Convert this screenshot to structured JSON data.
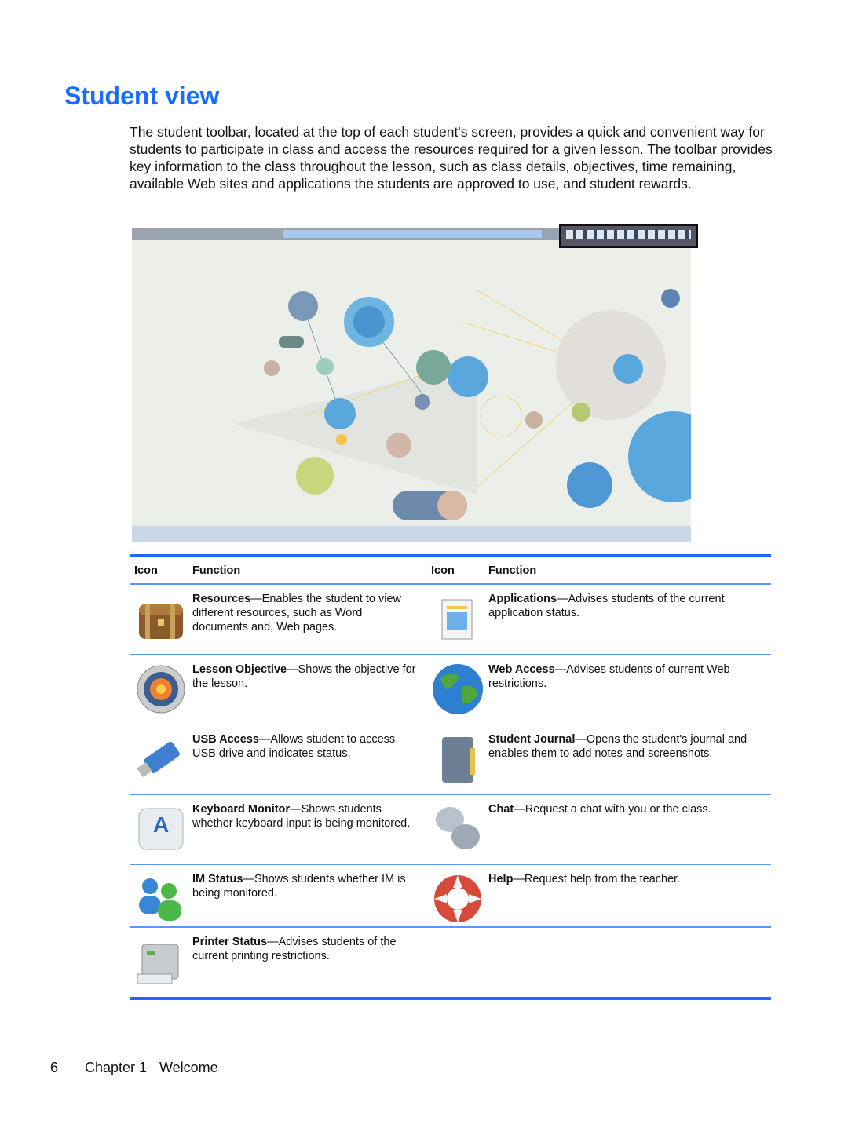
{
  "page": {
    "title": "Student view",
    "intro": "The student toolbar, located at the top of each student's screen, provides a quick and convenient way for students to participate in class and access the resources required for a given lesson. The toolbar provides key information to the class throughout the lesson, such as class details, objectives, time remaining, available Web sites and applications the students are approved to use, and student rewards."
  },
  "table": {
    "headers": [
      "Icon",
      "Function",
      "Icon",
      "Function"
    ],
    "rows": [
      [
        {
          "icon": "treasure-chest-icon",
          "name": "Resources",
          "desc": "—Enables the student to view different resources, such as Word documents and, Web pages."
        },
        {
          "icon": "application-document-icon",
          "name": "Applications",
          "desc": "—Advises students of the current application status."
        }
      ],
      [
        {
          "icon": "target-icon",
          "name": "Lesson Objective",
          "desc": "—Shows the objective for the lesson."
        },
        {
          "icon": "globe-icon",
          "name": "Web Access",
          "desc": "—Advises students of current Web restrictions."
        }
      ],
      [
        {
          "icon": "usb-drive-icon",
          "name": "USB Access",
          "desc": "—Allows student to access USB drive and indicates status."
        },
        {
          "icon": "journal-book-icon",
          "name": "Student Journal",
          "desc": "—Opens the student's journal and enables them to add notes and screenshots."
        }
      ],
      [
        {
          "icon": "keyboard-key-icon",
          "name": "Keyboard Monitor",
          "desc": "—Shows students whether keyboard input is being monitored."
        },
        {
          "icon": "chat-bubbles-icon",
          "name": "Chat",
          "desc": "—Request a chat with you or the class."
        }
      ],
      [
        {
          "icon": "im-users-icon",
          "name": "IM Status",
          "desc": "—Shows students whether IM is being monitored."
        },
        {
          "icon": "lifebuoy-icon",
          "name": "Help",
          "desc": "—Request help from the teacher."
        }
      ],
      [
        {
          "icon": "printer-icon",
          "name": "Printer Status",
          "desc": "—Advises students of the current printing restrictions."
        },
        null
      ]
    ]
  },
  "footer": {
    "page_number": "6",
    "chapter": "Chapter 1",
    "chapter_title": "Welcome"
  },
  "colors": {
    "accent": "#1a6cff",
    "rule": "#5b96ff"
  }
}
